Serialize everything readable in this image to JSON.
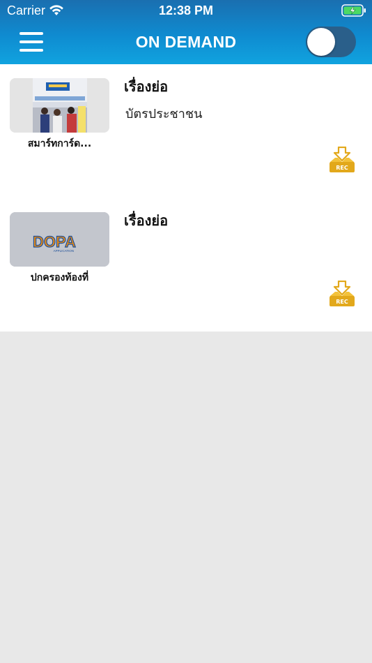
{
  "status_bar": {
    "carrier": "Carrier",
    "time": "12:38 PM"
  },
  "header": {
    "title": "ON DEMAND",
    "toggle_on": false,
    "background_color": "#0f8bd0"
  },
  "items": [
    {
      "heading": "เรื่องย่อ",
      "description": "บัตรประชาชน",
      "caption": "สมาร์ทการ์ด...",
      "thumbnail": "service-counter-photo",
      "action_icon": "rec-download-icon"
    },
    {
      "heading": "เรื่องย่อ",
      "description": "",
      "caption": "ปกครองท้องที่",
      "thumbnail": "dopa-logo",
      "logo_text": "DOPA",
      "logo_subtext": "APPLICATION",
      "action_icon": "rec-download-icon"
    }
  ],
  "rec_label": "REC",
  "accent_color": "#e2a81b"
}
